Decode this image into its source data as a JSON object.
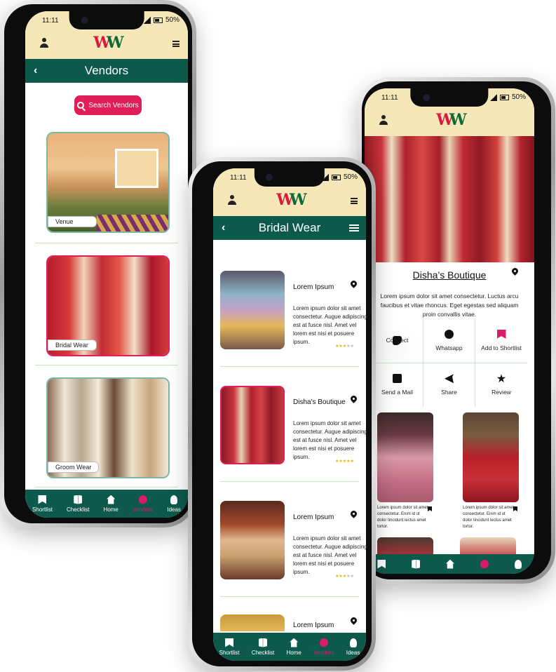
{
  "status": {
    "time": "11:11",
    "battery": "50%"
  },
  "logo": {
    "letter1": "W",
    "letter2": "W"
  },
  "colors": {
    "header": "#f5e7b8",
    "primary": "#0d5a4d",
    "accent": "#e01f5a",
    "divider": "#c5ebb8"
  },
  "phone1": {
    "title": "Vendors",
    "search_label": "Search Vendors",
    "categories": [
      {
        "label": "Venue"
      },
      {
        "label": "Bridal Wear"
      },
      {
        "label": "Groom Wear"
      }
    ]
  },
  "phone2": {
    "title": "Bridal Wear",
    "vendors": [
      {
        "name": "Lorem Ipsum",
        "description": "Lorem ipsum dolor sit amet consectetur. Augue adipiscing est at fusce nisl. Amet vel lorem est nisi et posuere ipsum.",
        "rating": 3
      },
      {
        "name": "Disha's Boutique",
        "description": "Lorem ipsum dolor sit amet consectetur. Augue adipiscing est at fusce nisl. Amet vel lorem est nisi et posuere ipsum.",
        "rating": 5
      },
      {
        "name": "Lorem Ipsum",
        "description": "Lorem ipsum dolor sit amet consectetur. Augue adipiscing est at fusce nisl. Amet vel lorem est nisi et posuere ipsum.",
        "rating": 3
      },
      {
        "name": "Lorem Ipsum"
      }
    ]
  },
  "phone3": {
    "title": "Disha’s Boutique",
    "description": "Lorem ipsum dolor sit amet consectetur. Luctus arcu faucibus et vitae rhoncus. Eget egestas sed aliquam proin convallis vitae.",
    "actions": [
      {
        "label": "Connect",
        "icon": "phone-icon"
      },
      {
        "label": "Whatsapp",
        "icon": "whatsapp-icon"
      },
      {
        "label": "Add to Shortlist",
        "icon": "bookmark-icon"
      },
      {
        "label": "Send a Mail",
        "icon": "mail-icon"
      },
      {
        "label": "Share",
        "icon": "share-icon"
      },
      {
        "label": "Review",
        "icon": "star-icon"
      }
    ],
    "gallery_caption": "Lorem ipsum dolor sit amet consectetur. Enim id ut dolor tincidunt lectus amet tortor."
  },
  "nav": [
    {
      "label": "Shortlist",
      "icon": "bookmark-icon"
    },
    {
      "label": "Checklist",
      "icon": "book-icon"
    },
    {
      "label": "Home",
      "icon": "home-icon"
    },
    {
      "label": "Vendors",
      "icon": "people-icon"
    },
    {
      "label": "Ideas",
      "icon": "bulb-icon"
    }
  ]
}
